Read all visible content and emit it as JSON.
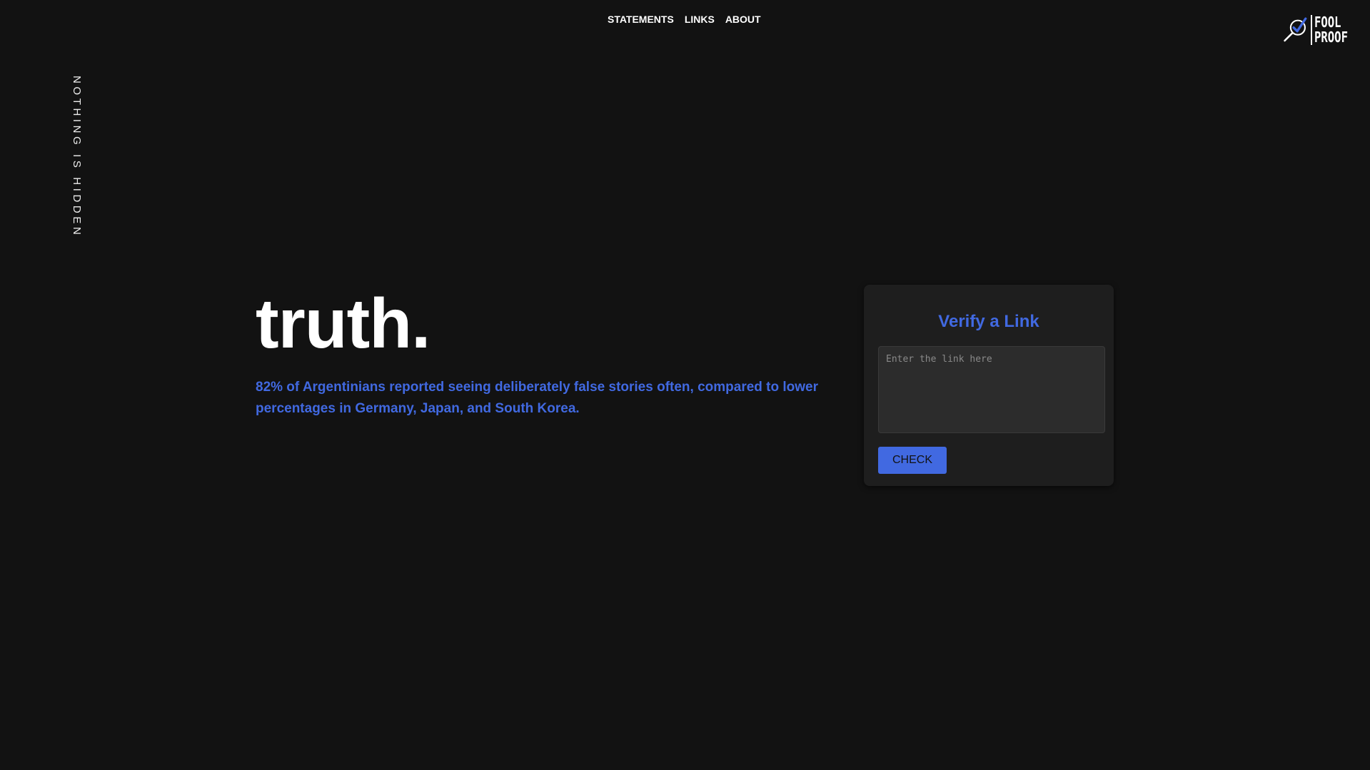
{
  "nav": {
    "items": [
      {
        "label": "STATEMENTS"
      },
      {
        "label": "LINKS"
      },
      {
        "label": "ABOUT"
      }
    ]
  },
  "logo": {
    "line1": "FOOL",
    "line2": "PROOF",
    "icon": "magnifier-check-icon"
  },
  "tagline": "NOTHING IS HIDDEN",
  "hero": {
    "title": "truth.",
    "fact": "82% of Argentinians reported seeing deliberately false stories often, compared to lower percentages in Germany, Japan, and South Korea."
  },
  "verify": {
    "title": "Verify a Link",
    "input_placeholder": "Enter the link here",
    "input_value": "",
    "button_label": "CHECK"
  },
  "colors": {
    "background": "#121212",
    "accent": "#4169e1",
    "card": "#1e1e1e",
    "input": "#2c2c2c"
  }
}
